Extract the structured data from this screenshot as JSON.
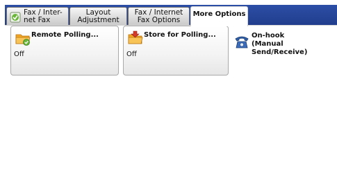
{
  "tabs": [
    {
      "label": "Fax / Inter-\nnet Fax",
      "icon": "fax-service-icon"
    },
    {
      "label": "Layout\nAdjustment"
    },
    {
      "label": "Fax / Internet\nFax Options"
    },
    {
      "label": "More Options",
      "active": true
    }
  ],
  "buttons": {
    "remote_polling": {
      "label": "Remote Polling...",
      "value": "Off",
      "icon": "remote-polling-folder-icon"
    },
    "store_for_polling": {
      "label": "Store for Polling...",
      "value": "Off",
      "icon": "store-polling-folder-icon"
    },
    "on_hook": {
      "label": "On-hook\n(Manual Send/Receive)",
      "icon": "telephone-icon"
    }
  },
  "colors": {
    "frame": "#213d8c",
    "tab_inactive": "#d8d8d8",
    "tab_active": "#ffffff",
    "folder": "#f2a623",
    "accent_green": "#6ab63a",
    "accent_red": "#d43a2a",
    "phone_blue": "#2f5fa8"
  }
}
